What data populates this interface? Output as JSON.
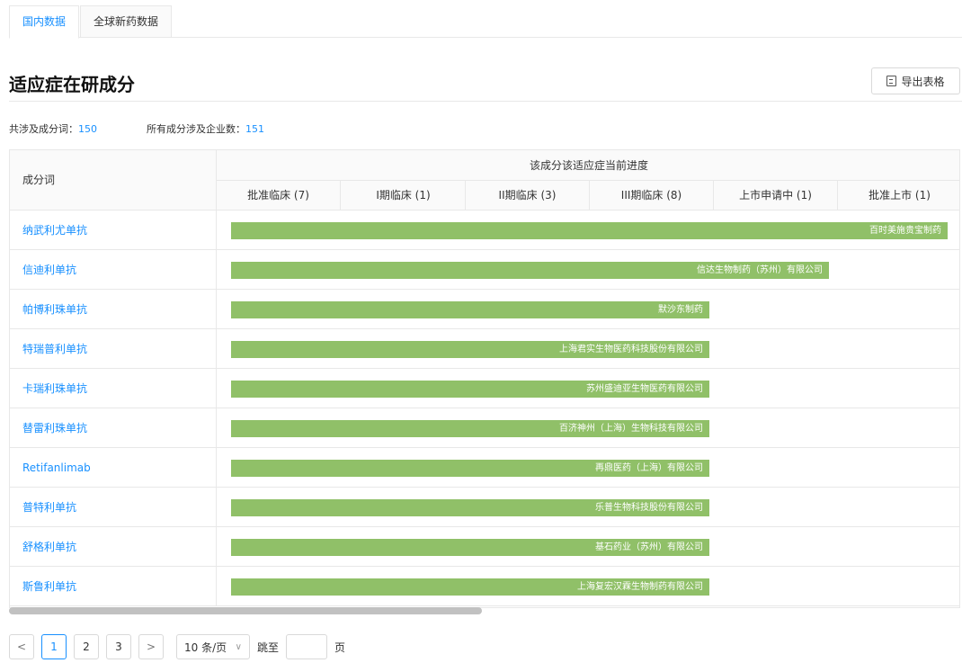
{
  "tabs": [
    {
      "label": "国内数据",
      "active": true
    },
    {
      "label": "全球新药数据",
      "active": false
    }
  ],
  "page_title": "适应症在研成分",
  "export_label": "导出表格",
  "stats": {
    "ingredient_label": "共涉及成分词：",
    "ingredient_count": "150",
    "company_label": "所有成分涉及企业数：",
    "company_count": "151"
  },
  "table": {
    "name_header": "成分词",
    "group_header": "该成分该适应症当前进度",
    "stages": [
      "批准临床 (7)",
      "I期临床 (1)",
      "II期临床 (3)",
      "III期临床 (8)",
      "上市申请中 (1)",
      "批准上市 (1)"
    ],
    "rows": [
      {
        "name": "纳武利尤单抗",
        "company": "百时美施贵宝制药",
        "stage_reached": 6
      },
      {
        "name": "信迪利单抗",
        "company": "信达生物制药（苏州）有限公司",
        "stage_reached": 5
      },
      {
        "name": "帕博利珠单抗",
        "company": "默沙东制药",
        "stage_reached": 4
      },
      {
        "name": "特瑞普利单抗",
        "company": "上海君实生物医药科技股份有限公司",
        "stage_reached": 4
      },
      {
        "name": "卡瑞利珠单抗",
        "company": "苏州盛迪亚生物医药有限公司",
        "stage_reached": 4
      },
      {
        "name": "替雷利珠单抗",
        "company": "百济神州（上海）生物科技有限公司",
        "stage_reached": 4
      },
      {
        "name": "Retifanlimab",
        "company": "再鼎医药（上海）有限公司",
        "stage_reached": 4
      },
      {
        "name": "普特利单抗",
        "company": "乐普生物科技股份有限公司",
        "stage_reached": 4
      },
      {
        "name": "舒格利单抗",
        "company": "基石药业（苏州）有限公司",
        "stage_reached": 4
      },
      {
        "name": "斯鲁利单抗",
        "company": "上海复宏汉霖生物制药有限公司",
        "stage_reached": 4
      }
    ]
  },
  "pagination": {
    "prev": "<",
    "pages": [
      "1",
      "2",
      "3"
    ],
    "current": "1",
    "next": ">",
    "page_size": "10 条/页",
    "jump_label": "跳至",
    "page_suffix": "页"
  },
  "colors": {
    "accent": "#1890ff",
    "bar": "#90c068"
  }
}
